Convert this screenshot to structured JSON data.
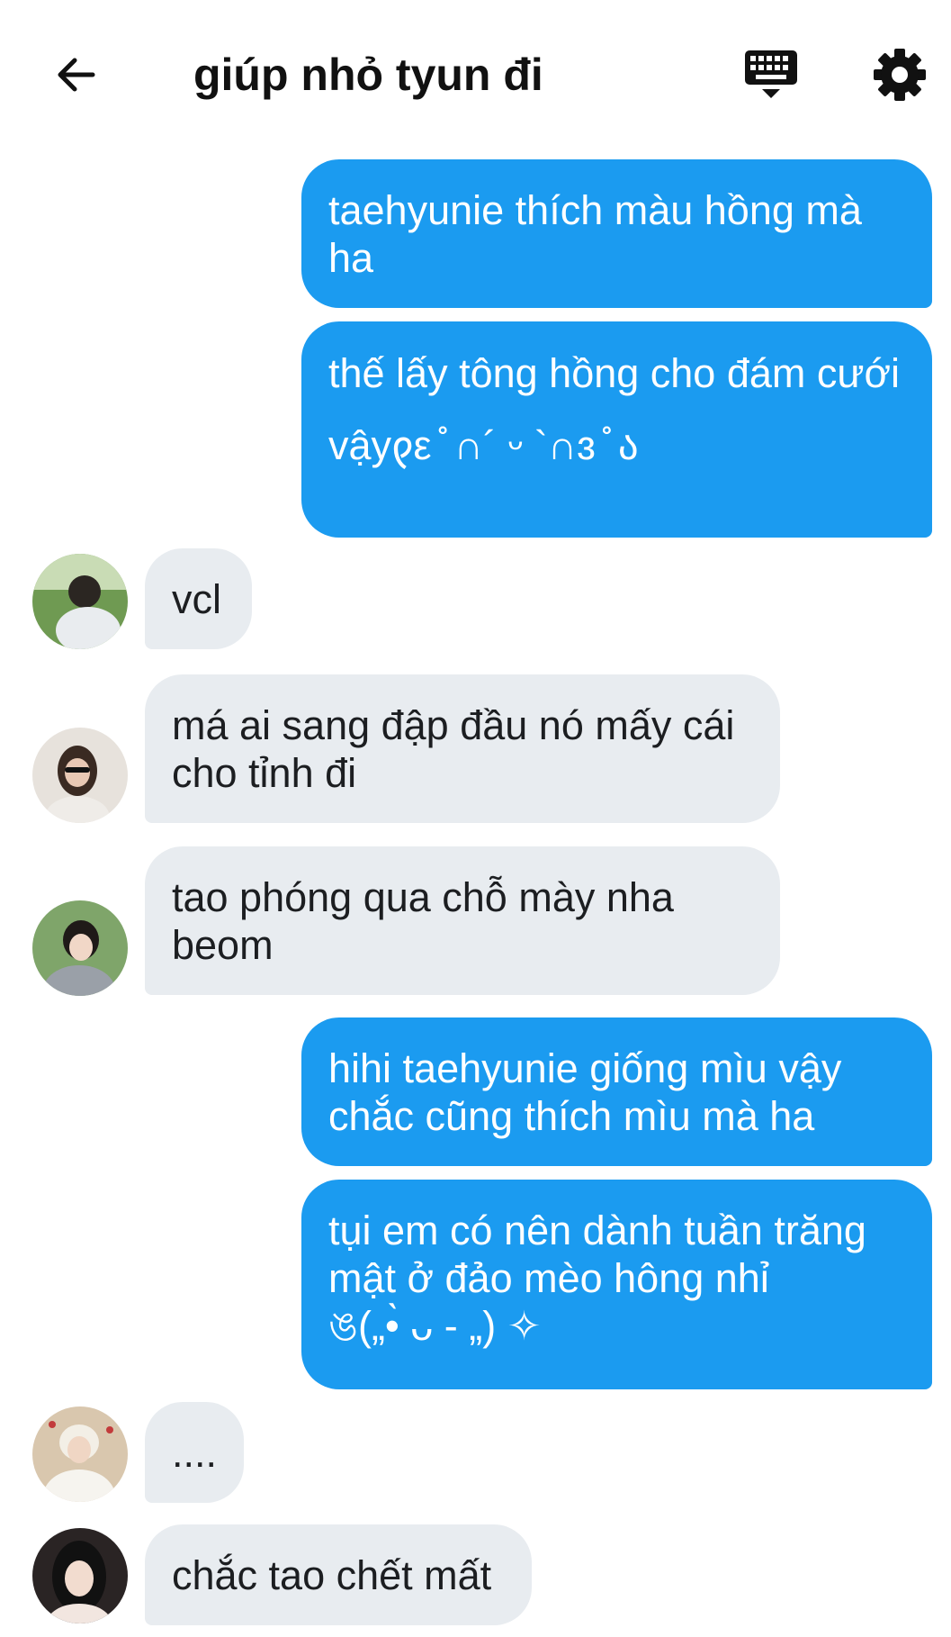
{
  "header": {
    "title": "giúp nhỏ tyun đi"
  },
  "messages": [
    {
      "side": "out",
      "text": "taehyunie thích màu hồng mà\nha"
    },
    {
      "side": "out",
      "text": "thế lấy tông hồng cho đám cưới\nvậy𐑞ε ̊̊ ∩´ ᵕ `∩ɜ ̊̊ ა"
    },
    {
      "side": "in",
      "text": "vcl"
    },
    {
      "side": "in",
      "text": "má ai sang đập đầu nó mấy cái\ncho tỉnh đi"
    },
    {
      "side": "in",
      "text": "tao phóng qua chỗ mày nha\nbeom"
    },
    {
      "side": "out",
      "text": "hihi taehyunie giống mìu vậy\nchắc cũng thích mìu mà ha"
    },
    {
      "side": "out",
      "text": "tụi em có nên dành tuần trăng\nmật ở đảo mèo hông nhỉ\nঙ(„•̀ ᴗ - „) ✧"
    },
    {
      "side": "in",
      "text": "...."
    },
    {
      "side": "in",
      "text": "chắc tao chết mất"
    }
  ],
  "icons": {
    "back": "arrow-left-icon",
    "keyboard": "keyboard-icon",
    "settings": "gear-icon"
  },
  "colors": {
    "outgoing_bubble": "#1b9bf0",
    "incoming_bubble": "#e8ecf0"
  }
}
